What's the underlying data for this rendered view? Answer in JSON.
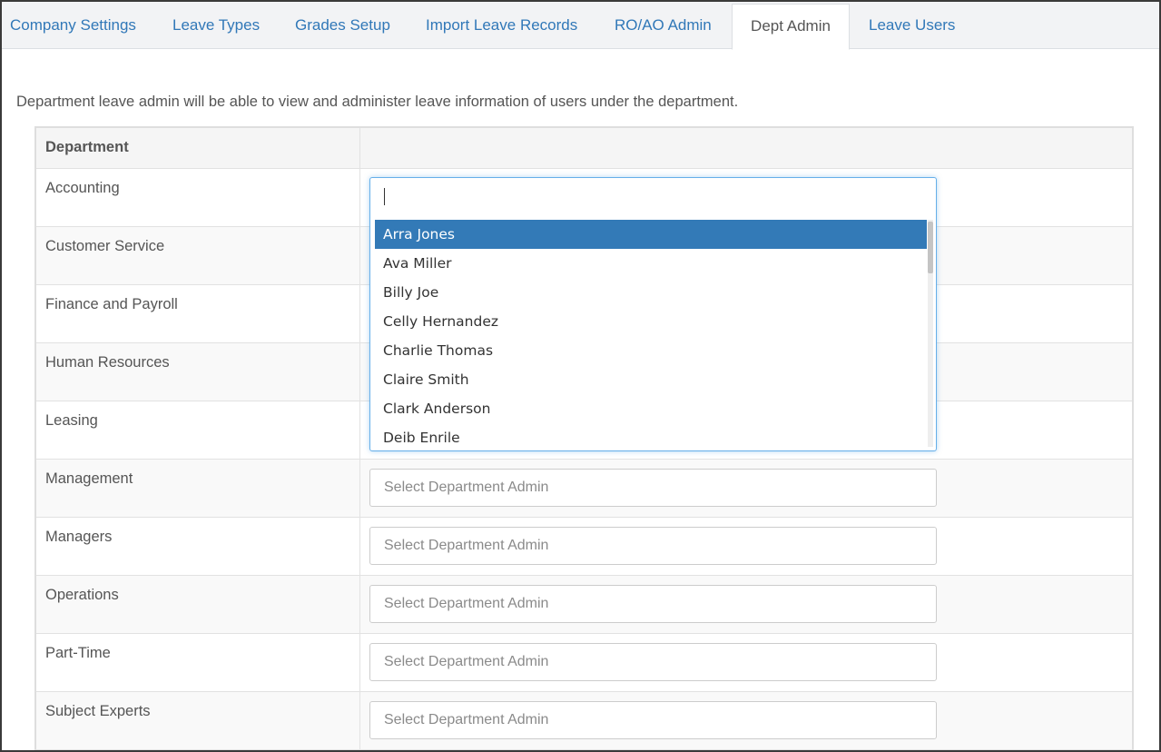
{
  "tabs": [
    {
      "label": "Company Settings"
    },
    {
      "label": "Leave Types"
    },
    {
      "label": "Grades Setup"
    },
    {
      "label": "Import Leave Records"
    },
    {
      "label": "RO/AO Admin"
    },
    {
      "label": "Dept Admin"
    },
    {
      "label": "Leave Users"
    }
  ],
  "active_tab": "Dept Admin",
  "intro_text": "Department leave admin will be able to view and administer leave information of users under the department.",
  "table": {
    "header_department": "Department",
    "header_admin": "",
    "select_placeholder": "Select Department Admin",
    "departments": [
      {
        "name": "Accounting"
      },
      {
        "name": "Customer Service"
      },
      {
        "name": "Finance and Payroll"
      },
      {
        "name": "Human Resources"
      },
      {
        "name": "Leasing"
      },
      {
        "name": "Management"
      },
      {
        "name": "Managers"
      },
      {
        "name": "Operations"
      },
      {
        "name": "Part-Time"
      },
      {
        "name": "Subject Experts"
      }
    ]
  },
  "dropdown": {
    "search_value": "",
    "options": [
      {
        "label": "Arra Jones",
        "highlighted": true
      },
      {
        "label": "Ava Miller"
      },
      {
        "label": "Billy Joe"
      },
      {
        "label": "Celly Hernandez"
      },
      {
        "label": "Charlie Thomas"
      },
      {
        "label": "Claire Smith"
      },
      {
        "label": "Clark Anderson"
      },
      {
        "label": "Deib Enrile"
      }
    ]
  },
  "colors": {
    "link": "#3178b8",
    "highlight": "#337ab7",
    "focus_border": "#66afe9"
  }
}
